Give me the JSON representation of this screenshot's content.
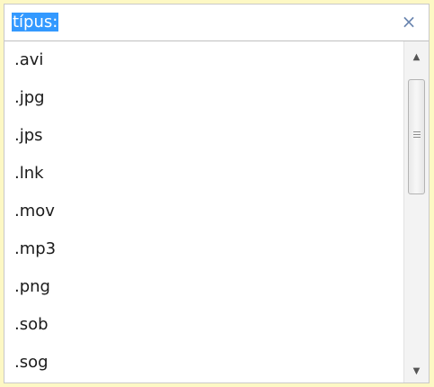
{
  "search": {
    "value": "típus:",
    "clear_icon": "×"
  },
  "list": {
    "items": [
      ".avi",
      ".jpg",
      ".jps",
      ".lnk",
      ".mov",
      ".mp3",
      ".png",
      ".sob",
      ".sog"
    ]
  },
  "scrollbar": {
    "up_icon": "▲",
    "down_icon": "▼"
  },
  "colors": {
    "background": "#fdf8c4",
    "selection": "#3399ff",
    "clear_icon": "#6b86b0"
  }
}
